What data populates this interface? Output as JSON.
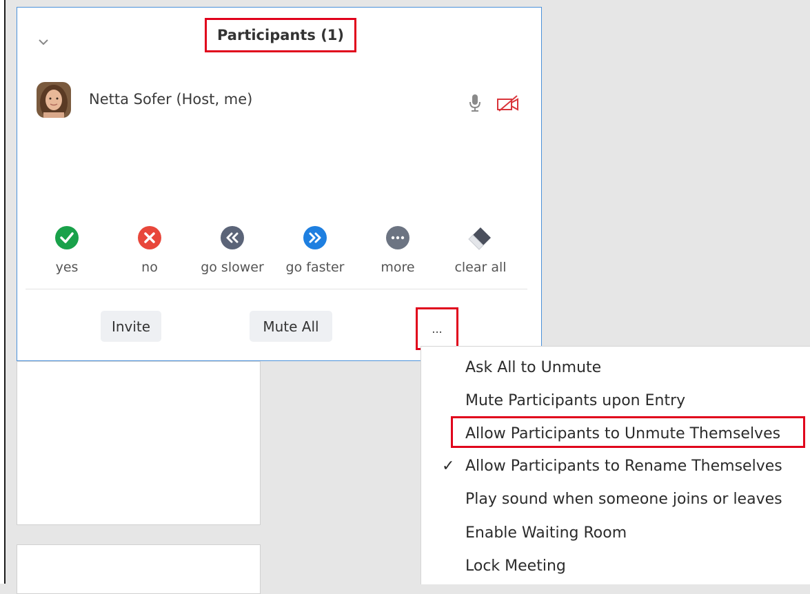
{
  "panel": {
    "title": "Participants (1)",
    "participant": {
      "name": "Netta Sofer (Host, me)"
    }
  },
  "reactions": [
    {
      "label": "yes",
      "icon": "check-circle-icon",
      "color": "#19a14a"
    },
    {
      "label": "no",
      "icon": "x-circle-icon",
      "color": "#e8473b"
    },
    {
      "label": "go slower",
      "icon": "rewind-circle-icon",
      "color": "#5b6478"
    },
    {
      "label": "go faster",
      "icon": "fast-forward-circle-icon",
      "color": "#1e7fe0"
    },
    {
      "label": "more",
      "icon": "ellipsis-circle-icon",
      "color": "#6c7482"
    },
    {
      "label": "clear all",
      "icon": "eraser-icon",
      "color": "#4a4f5c"
    }
  ],
  "buttons": {
    "invite": "Invite",
    "mute_all": "Mute All",
    "more": "..."
  },
  "menu": {
    "items": [
      {
        "label": "Ask All to Unmute",
        "checked": false
      },
      {
        "label": "Mute Participants upon Entry",
        "checked": false
      },
      {
        "label": "Allow Participants to Unmute Themselves",
        "checked": false
      },
      {
        "label": "Allow Participants to Rename Themselves",
        "checked": true
      },
      {
        "label": "Play sound when someone joins or leaves",
        "checked": false
      },
      {
        "label": "Enable Waiting Room",
        "checked": false
      },
      {
        "label": "Lock Meeting",
        "checked": false
      }
    ],
    "check_glyph": "✓"
  },
  "colors": {
    "highlight": "#e0001b",
    "panel_border": "#4a90d9",
    "cam_off": "#d9343a"
  }
}
